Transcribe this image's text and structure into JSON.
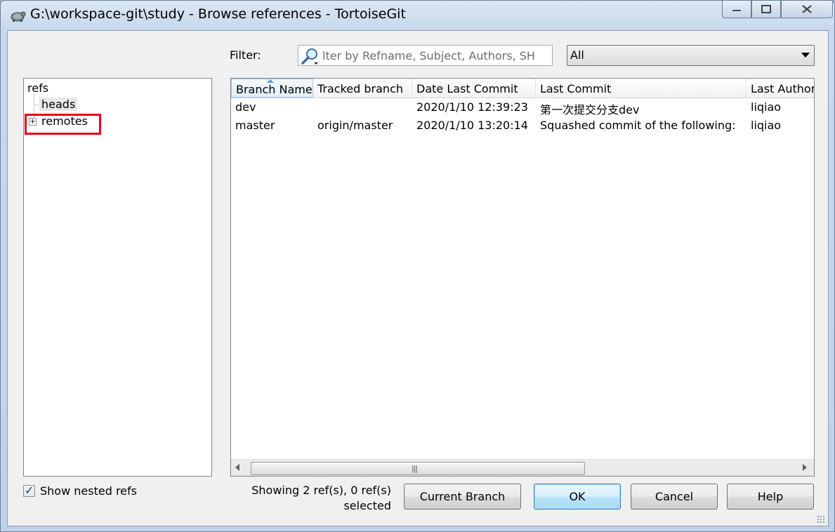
{
  "window": {
    "title": "G:\\workspace-git\\study - Browse references - TortoiseGit",
    "controls": {
      "minimize": "minimize-icon",
      "maximize": "maximize-icon",
      "close": "close-icon"
    }
  },
  "filter": {
    "label": "Filter:",
    "placeholder": "lter by Refname, Subject, Authors, SH",
    "scope_selected": "All"
  },
  "tree": {
    "root": "refs",
    "children": [
      "heads",
      "remotes"
    ]
  },
  "grid": {
    "columns": [
      "Branch Name",
      "Tracked branch",
      "Date Last Commit",
      "Last Commit",
      "Last Author"
    ],
    "sorted_column": "Branch Name",
    "rows": [
      {
        "branch": "dev",
        "tracked": "",
        "date": "2020/1/10 12:39:23",
        "commit": "第一次提交分支dev",
        "author": "liqiao"
      },
      {
        "branch": "master",
        "tracked": "origin/master",
        "date": "2020/1/10 13:20:14",
        "commit": "Squashed commit of the following:",
        "author": "liqiao"
      }
    ]
  },
  "options": {
    "show_nested_refs_label": "Show nested refs",
    "show_nested_refs_checked": true
  },
  "status": {
    "line1": "Showing 2 ref(s), 0 ref(s)",
    "line2": "selected"
  },
  "buttons": {
    "current_branch": "Current Branch",
    "ok": "OK",
    "cancel": "Cancel",
    "help": "Help"
  },
  "colors": {
    "highlight": "#e3001b",
    "default_button_border": "#3c7fb1"
  }
}
